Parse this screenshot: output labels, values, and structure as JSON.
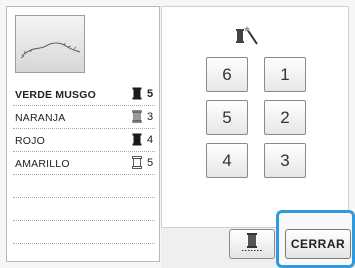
{
  "colors": {
    "highlight": "#2f9bdc",
    "panel_border": "#b9b9b9",
    "spool_filled": "#1a1a1a",
    "spool_partial": "#777777",
    "spool_empty": "#ffffff"
  },
  "color_list": [
    {
      "name": "VERDE MUSGO",
      "count": "5",
      "spool": "filled",
      "active": true
    },
    {
      "name": "NARANJA",
      "count": "3",
      "spool": "partial",
      "active": false
    },
    {
      "name": "ROJO",
      "count": "4",
      "spool": "filled",
      "active": false
    },
    {
      "name": "AMARILLO",
      "count": "5",
      "spool": "empty",
      "active": false
    }
  ],
  "order_buttons": [
    "6",
    "1",
    "5",
    "2",
    "4",
    "3"
  ],
  "actions": {
    "close_label": "CERRAR"
  },
  "icons": {
    "preview": "embroidery-preview-icon",
    "order": "spool-wand-icon",
    "thread_button": "thread-spool-icon"
  }
}
